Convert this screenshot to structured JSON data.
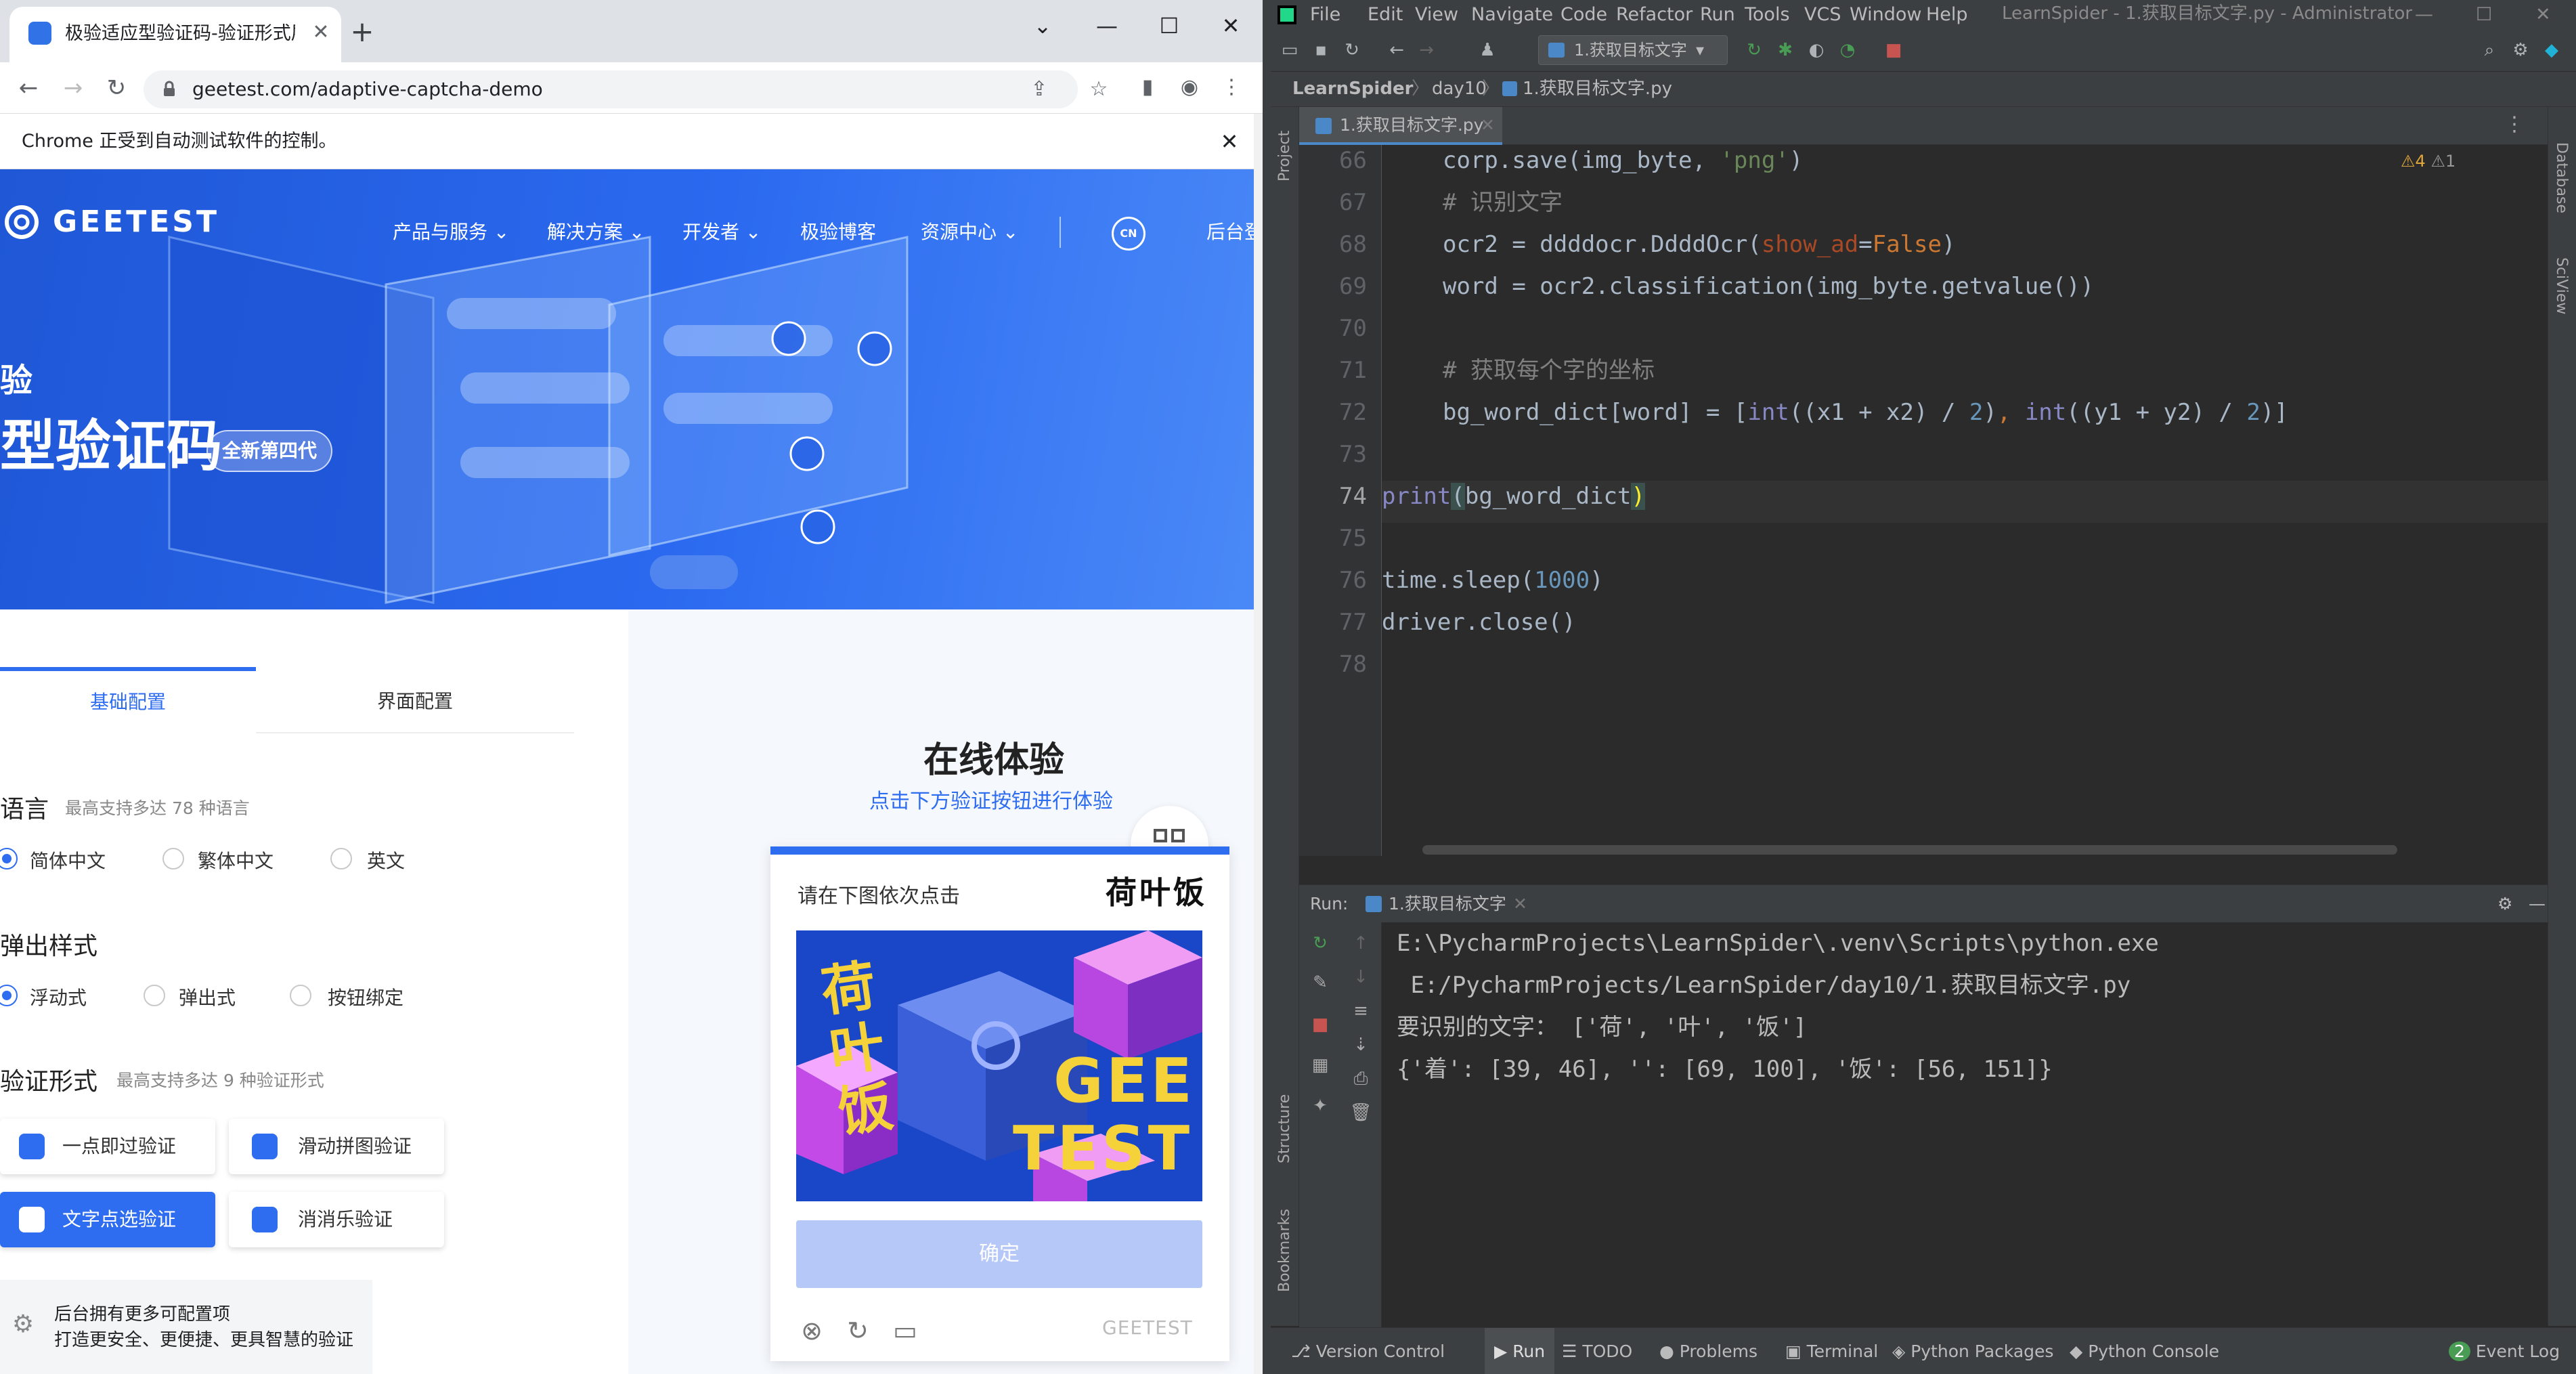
{
  "chrome": {
    "tab_title": "极验适应型验证码-验证形式展示",
    "url": "geetest.com/adaptive-captcha-demo",
    "infobar": "Chrome 正受到自动测试软件的控制。"
  },
  "site": {
    "logo": "GEETEST",
    "nav": [
      "产品与服务",
      "解决方案",
      "开发者",
      "极验博客",
      "资源中心",
      "后台登"
    ],
    "lang_badge": "CN",
    "hero_small": "验",
    "hero_title": "型验证码",
    "hero_badge": "全新第四代",
    "tabs": [
      "基础配置",
      "界面配置"
    ],
    "lang_title": "语言",
    "lang_sub": "最高支持多达 78 种语言",
    "lang_options": [
      "简体中文",
      "繁体中文",
      "英文"
    ],
    "popup_title": "弹出样式",
    "popup_options": [
      "浮动式",
      "弹出式",
      "按钮绑定"
    ],
    "form_title": "验证形式",
    "form_sub": "最高支持多达 9 种验证形式",
    "verify_buttons": [
      "一点即过验证",
      "滑动拼图验证",
      "文字点选验证",
      "消消乐验证"
    ],
    "more_line1": "后台拥有更多可配置项",
    "more_line2": "打造更安全、更便捷、更具智慧的验证",
    "online_title": "在线体验",
    "online_sub": "点击下方验证按钮进行体验",
    "captcha_prompt": "请在下图依次点击",
    "captcha_words": "荷叶饭",
    "captcha_img_text": "荷叶饭",
    "captcha_img_brand1": "GEE",
    "captcha_img_brand2": "TEST",
    "captcha_confirm": "确定",
    "captcha_brand": "GEETEST"
  },
  "ide": {
    "menus": [
      "File",
      "Edit",
      "View",
      "Navigate",
      "Code",
      "Refactor",
      "Run",
      "Tools",
      "VCS",
      "Window",
      "Help"
    ],
    "window_title": "LearnSpider - 1.获取目标文字.py - Administrator",
    "run_config": "1.获取目标文字",
    "breadcrumbs": [
      "LearnSpider",
      "day10",
      "1.获取目标文字.py"
    ],
    "editor_tab": "1.获取目标文字.py",
    "inspections": [
      "4",
      "1"
    ],
    "line_numbers": [
      "66",
      "67",
      "68",
      "69",
      "70",
      "71",
      "72",
      "73",
      "74",
      "75",
      "76",
      "77",
      "78"
    ],
    "current_line": "74",
    "left_tools": [
      "Project",
      "Structure",
      "Bookmarks"
    ],
    "right_tools": [
      "Database",
      "SciView"
    ],
    "run_label": "Run:",
    "run_tab": "1.获取目标文字",
    "console": [
      "E:\\PycharmProjects\\LearnSpider\\.venv\\Scripts\\python.exe",
      " E:/PycharmProjects/LearnSpider/day10/1.获取目标文字.py",
      "要识别的文字： ['荷', '叶', '饭']",
      "{'着': [39, 46], '': [69, 100], '饭': [56, 151]}"
    ],
    "status_items": [
      "Version Control",
      "Run",
      "TODO",
      "Problems",
      "Terminal",
      "Python Packages",
      "Python Console"
    ],
    "event_log": "Event Log",
    "event_count": "2"
  },
  "colors": {
    "brand_blue": "#2e6cf0",
    "ide_bg": "#2b2b2b",
    "ide_panel": "#3c3f41",
    "keyword": "#cc7832",
    "string": "#6a8759",
    "number": "#6897bb"
  }
}
